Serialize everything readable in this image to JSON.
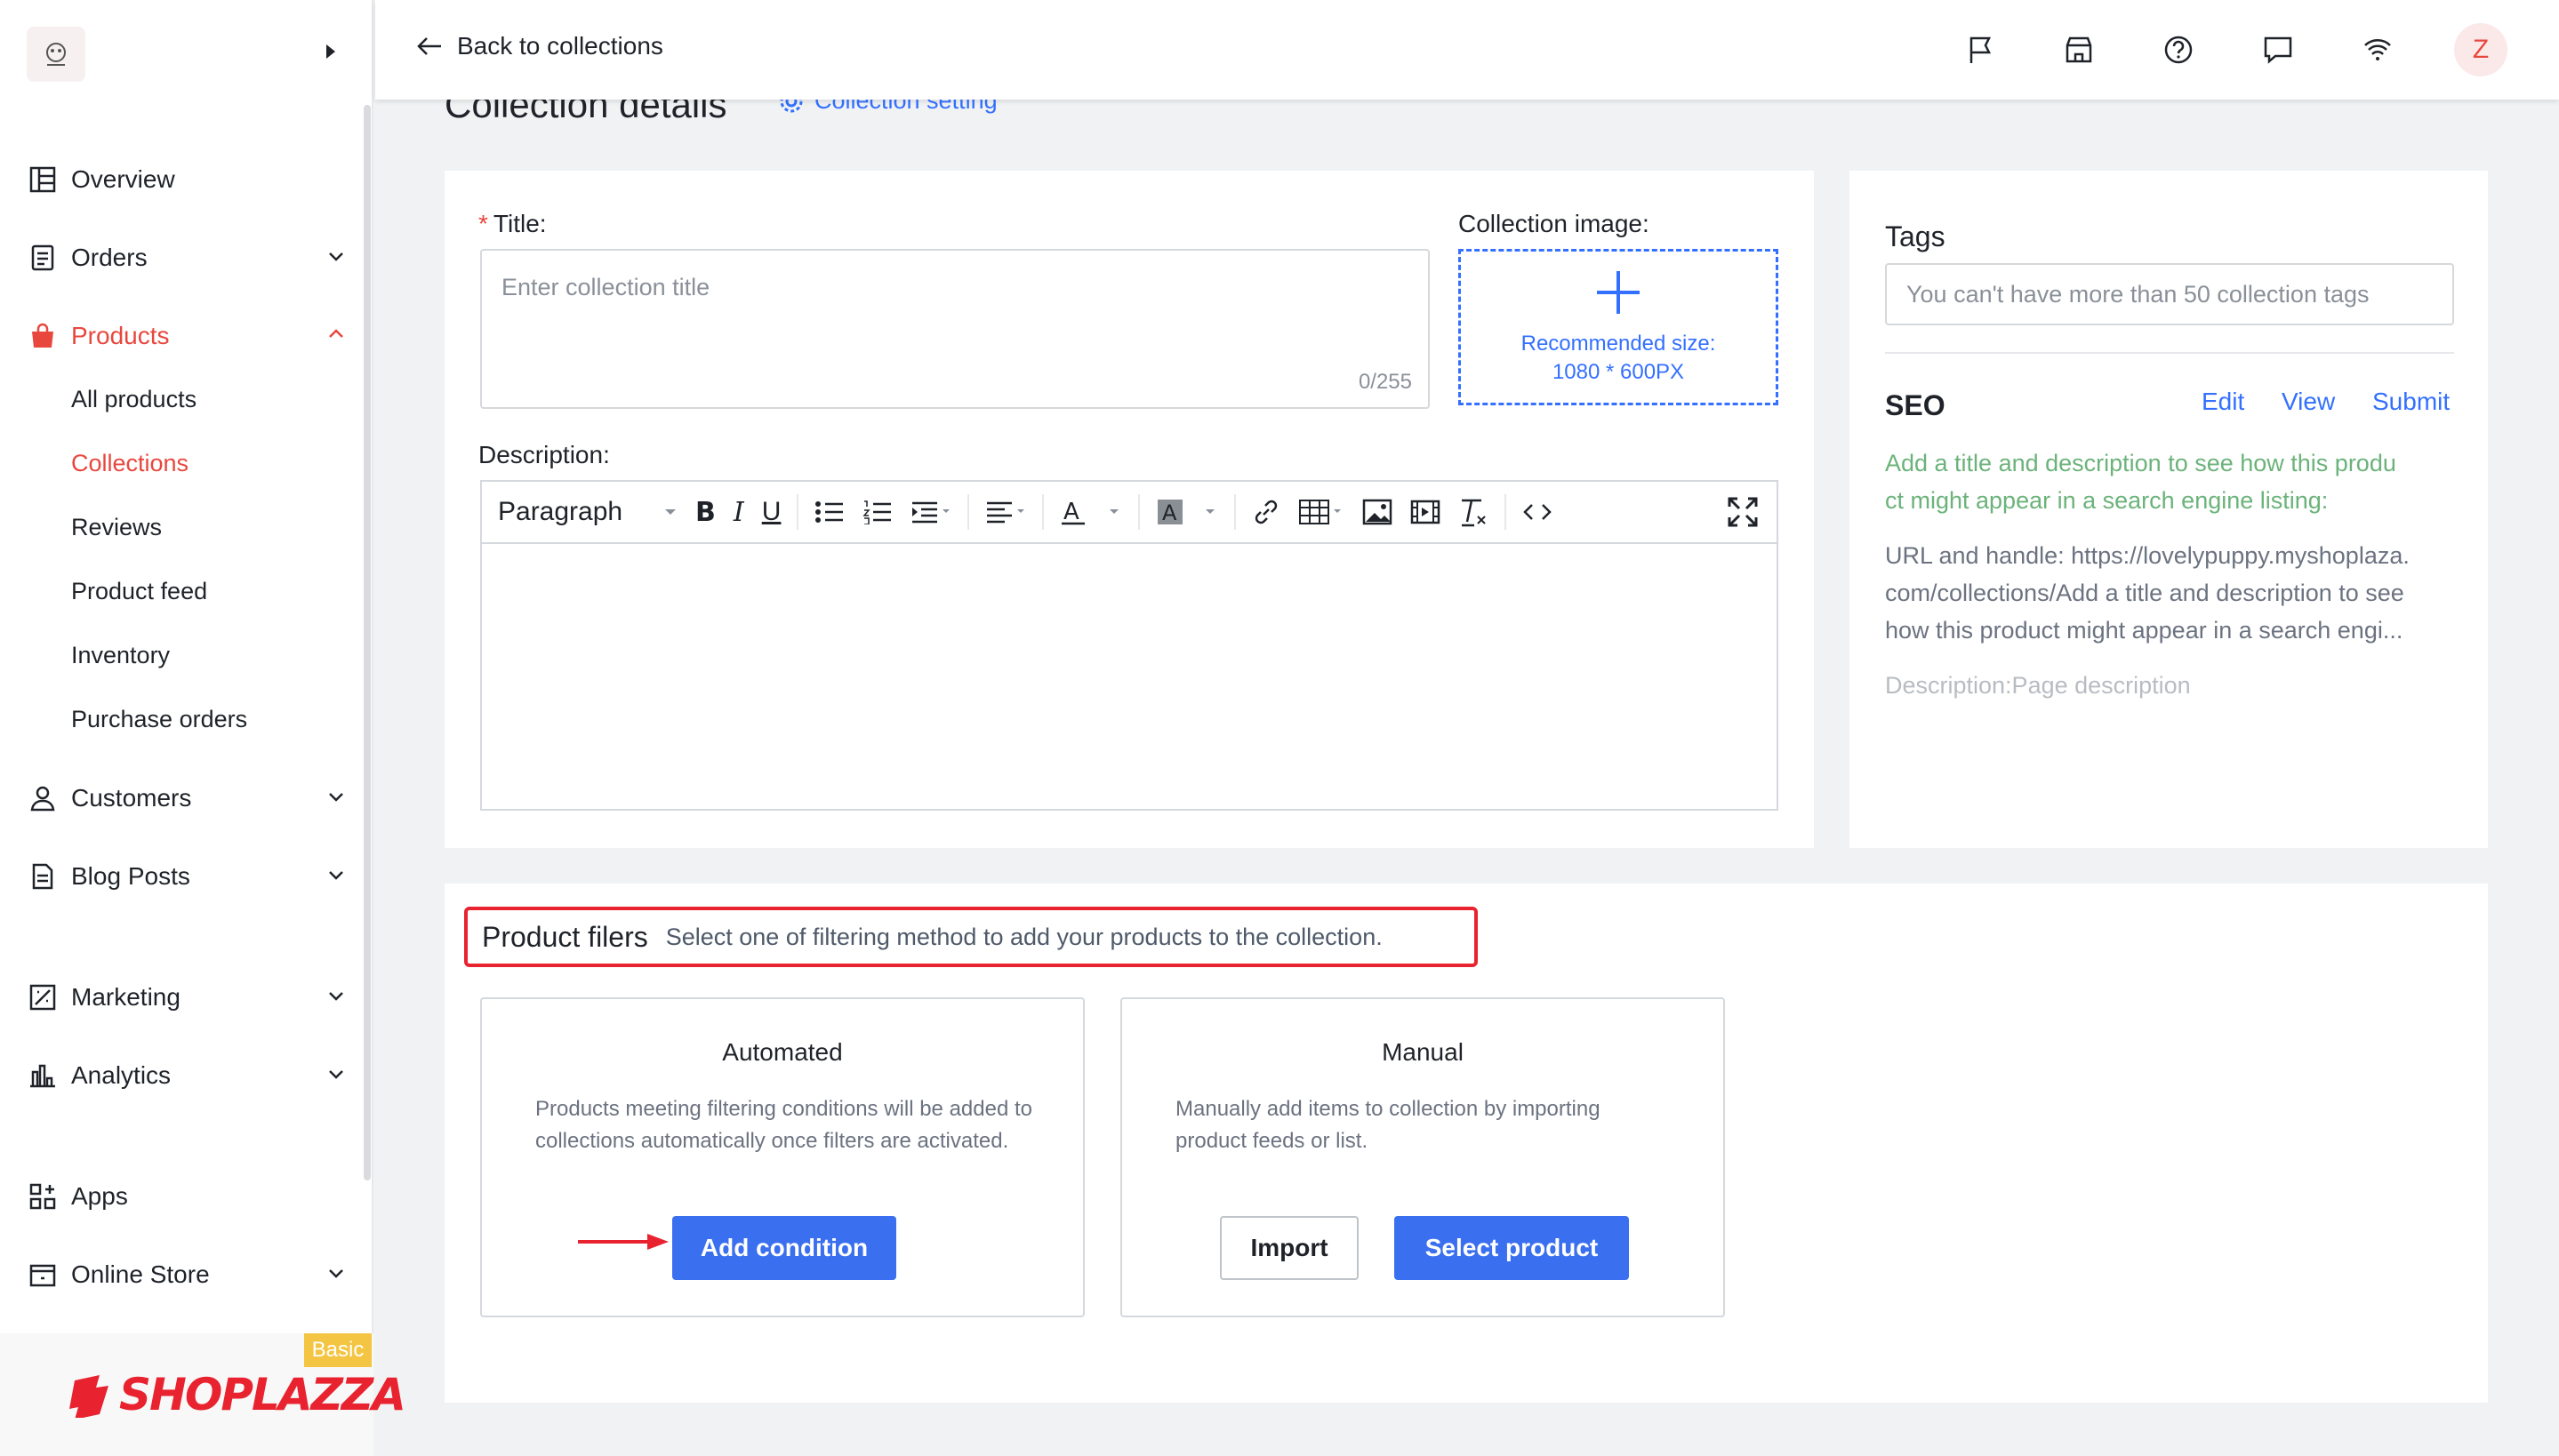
{
  "sidebar": {
    "nav": [
      {
        "label": "Overview",
        "icon": "dashboard-icon",
        "chevron": ""
      },
      {
        "label": "Orders",
        "icon": "orders-icon",
        "chevron": "down"
      },
      {
        "label": "Products",
        "icon": "shopping-bag-icon",
        "chevron": "up"
      },
      {
        "label": "Customers",
        "icon": "person-icon",
        "chevron": "down"
      },
      {
        "label": "Blog Posts",
        "icon": "document-icon",
        "chevron": "down"
      },
      {
        "label": "Marketing",
        "icon": "marketing-icon",
        "chevron": "down"
      },
      {
        "label": "Analytics",
        "icon": "analytics-icon",
        "chevron": "down"
      },
      {
        "label": "Apps",
        "icon": "apps-icon",
        "chevron": ""
      },
      {
        "label": "Online Store",
        "icon": "store-icon",
        "chevron": "down"
      }
    ],
    "product_sub": [
      "All products",
      "Collections",
      "Reviews",
      "Product feed",
      "Inventory",
      "Purchase orders"
    ],
    "active_sub": "Collections",
    "plan_badge": "Basic",
    "brand": "SHOPLAZZA",
    "accent_color": "#e8473e"
  },
  "topbar": {
    "back_label": "Back to collections",
    "icons": [
      "flag-icon",
      "store-front-icon",
      "help-icon",
      "chat-icon",
      "wifi-icon"
    ],
    "avatar_initial": "Z"
  },
  "page": {
    "title": "Collection details",
    "collection_setting": "Collection setting"
  },
  "form": {
    "title_label": "Title",
    "title_required_mark": "*",
    "title_placeholder": "Enter collection title",
    "title_counter": "0/255",
    "image_label": "Collection image",
    "image_hint_line1": "Recommended size:",
    "image_hint_line2": "1080 * 600PX",
    "description_label": "Description",
    "editor_format": "Paragraph"
  },
  "tags": {
    "heading": "Tags",
    "placeholder": "You can't have more than 50 collection tags"
  },
  "seo": {
    "heading": "SEO",
    "edit": "Edit",
    "view": "View",
    "submit": "Submit",
    "hint_line1": "Add a title and description to see how this produ",
    "hint_line2": "ct might appear in a search engine listing:",
    "url_line1": "URL and handle: https://lovelypuppy.myshoplaza.",
    "url_line2": "com/collections/Add a title and description to see",
    "url_line3": "how this product might appear in a search engi...",
    "description": "Description:Page description"
  },
  "filters": {
    "heading": "Product filers",
    "subheading": "Select one of filtering method to add your products to the collection.",
    "automated": {
      "title": "Automated",
      "description": "Products meeting filtering conditions will be added to collections automatically once filters are activated.",
      "button": "Add condition"
    },
    "manual": {
      "title": "Manual",
      "description": "Manually add items to collection by importing product feeds or list.",
      "import_button": "Import",
      "select_button": "Select product"
    }
  }
}
